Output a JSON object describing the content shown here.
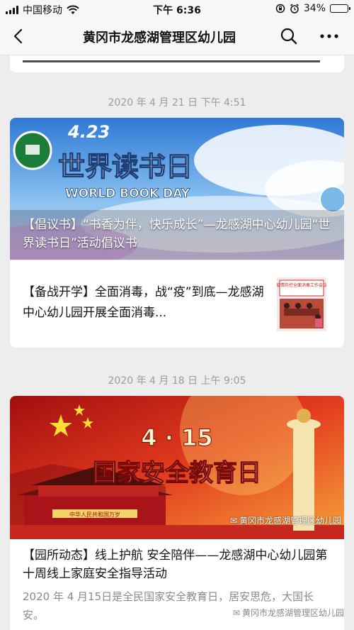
{
  "status": {
    "carrier": "中国移动",
    "time": "下午 6:36",
    "battery": "34%",
    "battery_level": 0.34
  },
  "nav": {
    "title": "黄冈市龙感湖管理区幼儿园",
    "icons": [
      "back-icon",
      "search-icon",
      "more-icon"
    ]
  },
  "feed": [
    {
      "timestamp": "2020 年 4 月 21 日 下午 4:51",
      "hero": {
        "banner_date": "4.23",
        "banner_title": "世界读书日",
        "banner_subtitle": "WORLD BOOK DAY",
        "caption": "【倡议书】“书香为伴，快乐成长”—龙感湖中心幼儿园“世界读书日”活动倡议书"
      },
      "sub_items": [
        {
          "title": "【备战开学】全面消毒，战“疫”到底—龙感湖中心幼儿园开展全面消毒...",
          "thumb_caption": "疫情防控全面消毒工作会议"
        }
      ]
    },
    {
      "timestamp": "2020 年 4 月 18 日 上午 9:05",
      "hero": {
        "banner_date": "4 · 15",
        "banner_title": "国家安全教育日",
        "gate_sign": "中华人民共和国万岁",
        "watermark": "黄冈市龙感湖管理区幼儿园"
      },
      "title": "【园所动态】线上护航  安全陪伴——龙感湖中心幼儿园第十周线上家庭安全指导活动",
      "description": "2020 年 4 月15日是全民国家安全教育日，居安思危，大国长安。",
      "watermark": "黄冈市龙感湖管理区幼儿园"
    }
  ],
  "colors": {
    "accent_red": "#c8161d",
    "background": "#ededed",
    "gold": "#f6d365"
  }
}
